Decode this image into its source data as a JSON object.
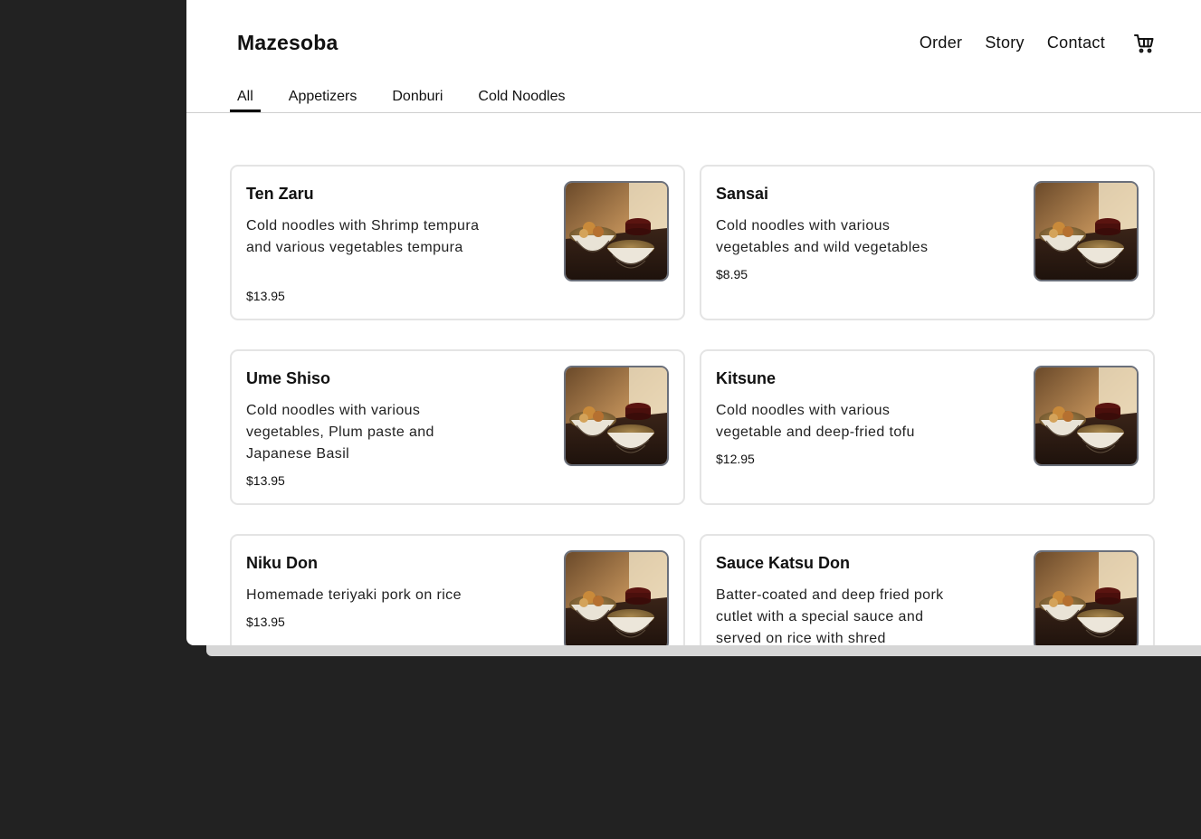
{
  "brand": "Mazesoba",
  "nav": {
    "order": "Order",
    "story": "Story",
    "contact": "Contact"
  },
  "icons": {
    "cart": "cart-icon",
    "dish": "food-photo"
  },
  "tabs": [
    {
      "label": "All",
      "active": true
    },
    {
      "label": "Appetizers",
      "active": false
    },
    {
      "label": "Donburi",
      "active": false
    },
    {
      "label": "Cold Noodles",
      "active": false
    }
  ],
  "items": [
    {
      "name": "Ten Zaru",
      "description": "Cold noodles with Shrimp tempura and various vegetables tempura",
      "price": "$13.95"
    },
    {
      "name": "Sansai",
      "description": "Cold noodles with various vegetables and wild vegetables",
      "price": "$8.95"
    },
    {
      "name": "Ume Shiso",
      "description": "Cold noodles with various vegetables, Plum paste and Japanese Basil",
      "price": "$13.95"
    },
    {
      "name": "Kitsune",
      "description": "Cold noodles with various vegetable and deep-fried tofu",
      "price": "$12.95"
    },
    {
      "name": "Niku Don",
      "description": "Homemade teriyaki pork on rice",
      "price": "$13.95"
    },
    {
      "name": "Sauce Katsu Don",
      "description": "Batter-coated and deep fried pork cutlet with a special sauce and served on rice with shred",
      "price": ""
    }
  ],
  "colors": {
    "accent": "#000000",
    "backdrop": "#222222",
    "card_border": "#e4e4e4"
  }
}
